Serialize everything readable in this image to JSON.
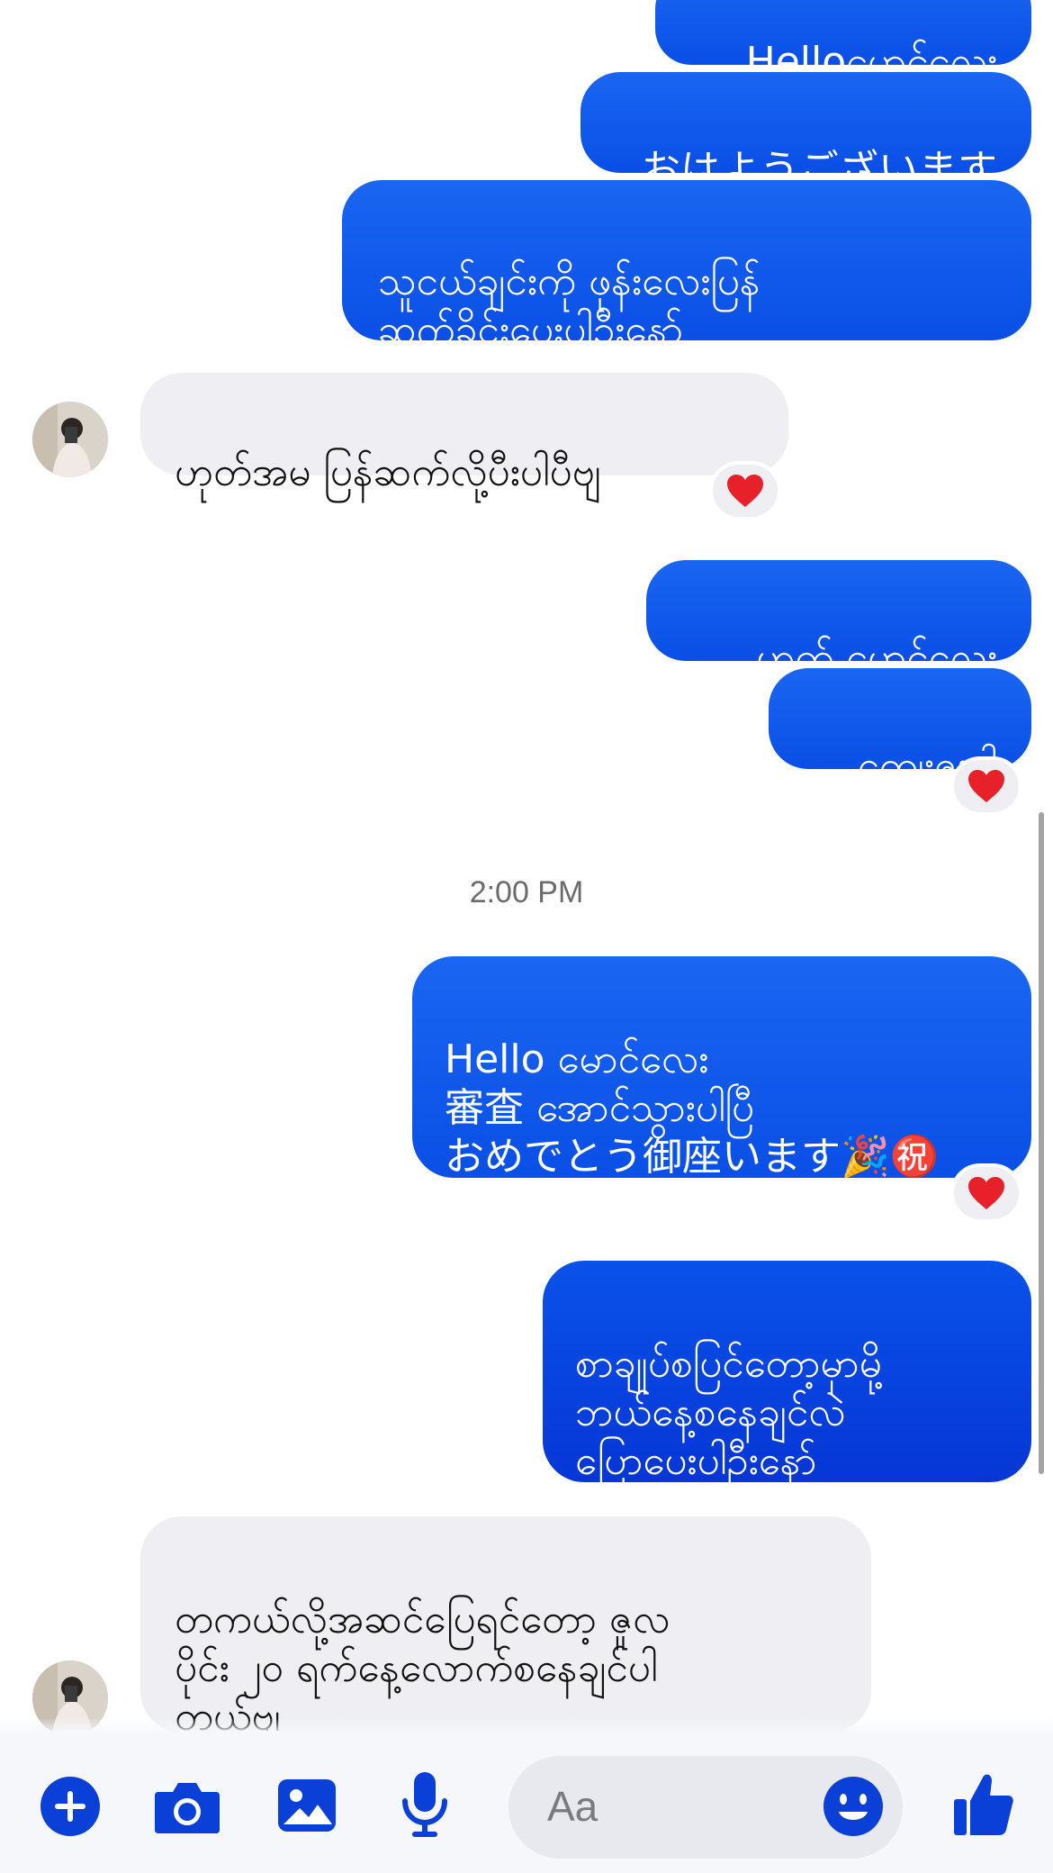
{
  "messages": {
    "m1": "Helloမောင်လေး",
    "m2": "おはようございます",
    "m3": "သူငယ်ချင်းကို ဖုန်းလေးပြန်\nဆက်ခိုင်းပေးပါဦးနော်",
    "m4": "ဟုတ်အမ ပြန်ဆက်လို့ပီးပါပီဗျ",
    "m5": "ဟုတ် မောင်လေး",
    "m6": "ကျေးဇူးပါ",
    "timestamp": "2:00 PM",
    "m7": "Hello မောင်လေး\n審査 အောင်သွားပါပြီ\nおめでとう御座います🎉㊗️",
    "m8": "စာချုပ်စပြင်တော့မှာမို့\nဘယ်နေ့စနေချင်လဲ\nပြောပေးပါဦးနော်",
    "m9": "တကယ်လို့အဆင်ပြေရင်တော့ ဇူလ\nပိုင်း ၂၀ ရက်နေ့လောက်စနေချင်ပါ\nတယ်ဗျ"
  },
  "reactions": {
    "heart": "❤️"
  },
  "composer": {
    "placeholder": "Aa",
    "icons": [
      "plus-icon",
      "camera-icon",
      "image-icon",
      "microphone-icon",
      "emoji-icon",
      "thumbs-up-icon"
    ]
  },
  "colors": {
    "accent": "#0a4fe6",
    "outgoing_bubble": "#1a66f2",
    "incoming_bubble": "#efeff3",
    "reaction_heart": "#e8202a",
    "icon_blue": "#0a3fd8"
  }
}
